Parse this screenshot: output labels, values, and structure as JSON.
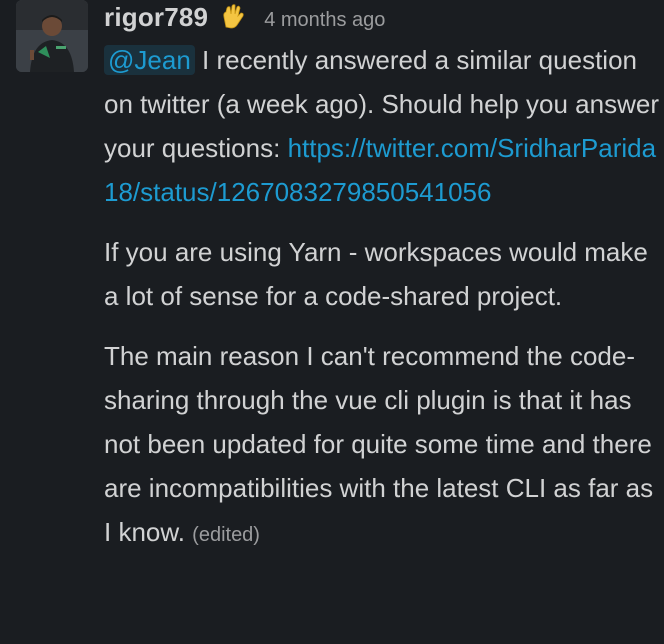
{
  "message": {
    "username": "rigor789",
    "status_emoji": "vulcan-salute-icon",
    "timestamp": "4 months ago",
    "mention": "@Jean",
    "para1_text": " I recently answered a similar question on twitter (a week ago). Should help you answer your questions: ",
    "link_text": "https://twitter.com/SridharParida18/status/1267083279850541056",
    "para2": "If you are using Yarn - workspaces would make a lot of sense for a code-shared project.",
    "para3": "The main reason I can't recommend the code-sharing through the vue cli plugin is that it has not been updated for quite some time and there are incompatibilities with the latest CLI as far as I know. ",
    "edited_label": "(edited)"
  },
  "colors": {
    "background": "#1a1d21",
    "text": "#d1d2d3",
    "muted": "#9b9c9e",
    "link": "#1d9bd1"
  }
}
